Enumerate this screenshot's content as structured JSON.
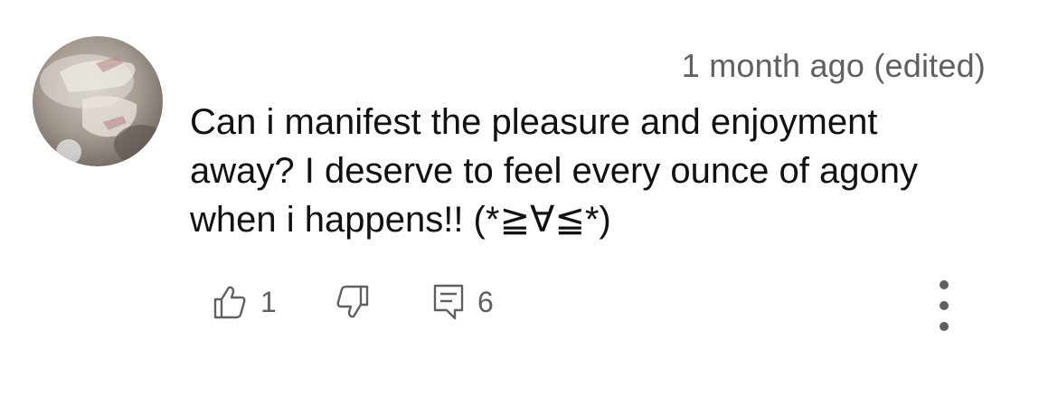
{
  "comment": {
    "timestamp": "1 month ago (edited)",
    "text_lines": [
      "Can i manifest the pleasure and enjoyment",
      "away? I deserve to feel every ounce of agony",
      "when i happens!! (*≧∀≦*)"
    ]
  },
  "actions": {
    "like": {
      "icon": "thumbs-up-icon",
      "count": "1"
    },
    "dislike": {
      "icon": "thumbs-down-icon"
    },
    "reply": {
      "icon": "comment-icon",
      "count": "6"
    },
    "more": {
      "icon": "more-vertical-icon"
    }
  },
  "colors": {
    "text": "#111111",
    "secondary_text": "#606060",
    "background": "#ffffff"
  }
}
